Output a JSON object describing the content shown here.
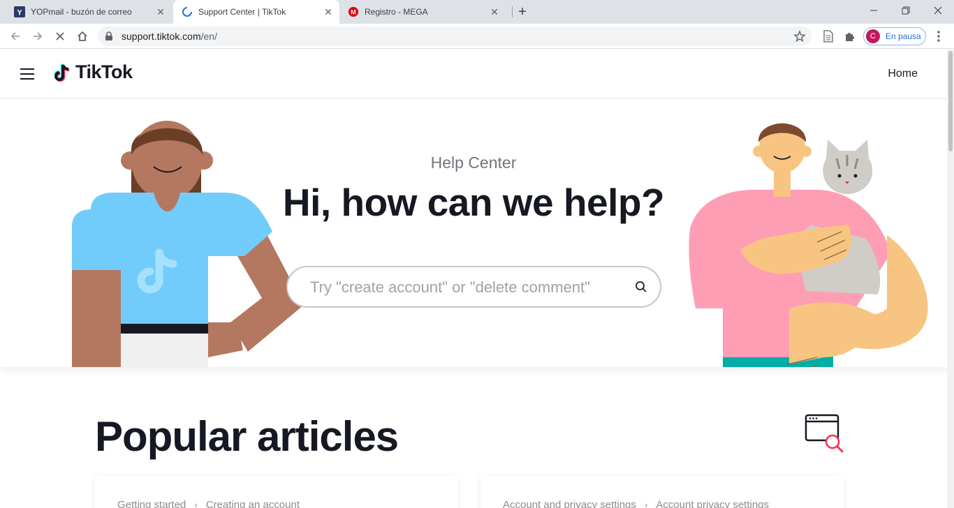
{
  "browser": {
    "tabs": [
      {
        "title": "YOPmail - buzón de correo",
        "favicon": "yopmail-icon",
        "active": false
      },
      {
        "title": "Support Center | TikTok",
        "favicon": "loading-spinner-icon",
        "active": true
      },
      {
        "title": "Registro - MEGA",
        "favicon": "mega-icon",
        "active": false
      }
    ],
    "url": {
      "host": "support.tiktok.com",
      "path": "/en/"
    },
    "profile": {
      "initial": "C",
      "label": "En pausa"
    }
  },
  "site": {
    "logo_text": "TikTok",
    "nav_home": "Home"
  },
  "hero": {
    "subtitle": "Help Center",
    "title": "Hi, how can we help?",
    "search_placeholder": "Try \"create account\" or \"delete comment\""
  },
  "popular": {
    "heading": "Popular articles",
    "cards": [
      {
        "crumbs": [
          "Getting started",
          "Creating an account"
        ]
      },
      {
        "crumbs": [
          "Account and privacy settings",
          "Account privacy settings"
        ]
      }
    ]
  },
  "colors": {
    "tiktok_cyan": "#25f4ee",
    "tiktok_red": "#fe2c55",
    "text_dark": "#161823"
  }
}
